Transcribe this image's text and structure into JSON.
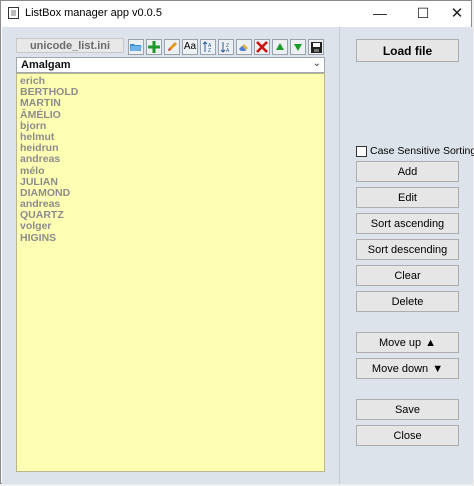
{
  "window": {
    "title": "ListBox manager app v0.0.5",
    "controls": {
      "minimize": "—",
      "maximize": "☐",
      "close": "✕"
    }
  },
  "file": {
    "name": "unicode_list.ini"
  },
  "toolbar": {
    "buttons": [
      {
        "name": "open-folder-icon",
        "glyph": ""
      },
      {
        "name": "add-icon",
        "glyph": ""
      },
      {
        "name": "edit-pencil-icon",
        "glyph": ""
      },
      {
        "name": "font-case-icon",
        "glyph": "Aa"
      },
      {
        "name": "sort-ascending-icon",
        "glyph": ""
      },
      {
        "name": "sort-descending-icon",
        "glyph": ""
      },
      {
        "name": "clear-eraser-icon",
        "glyph": ""
      },
      {
        "name": "delete-icon",
        "glyph": ""
      },
      {
        "name": "move-up-icon",
        "glyph": ""
      },
      {
        "name": "move-down-icon",
        "glyph": ""
      },
      {
        "name": "save-disk-icon",
        "glyph": ""
      }
    ]
  },
  "combo": {
    "selected": "Amalgam",
    "arrow": "⌄"
  },
  "list": {
    "items": [
      "erich",
      "BERTHOLD",
      "MARTIN",
      "ÂMÉLIO",
      "bjorn",
      "helmut",
      "heidrun",
      "andreas",
      "mélo",
      "JULIAN",
      "DIAMOND",
      "andreas",
      "QUARTZ",
      "volger",
      "HIGINS"
    ],
    "text_color": "#8c8c8c",
    "background": "#ffffb4"
  },
  "right": {
    "load_file": "Load file",
    "case_sensitive": "Case Sensitive Sorting",
    "case_sensitive_checked": false,
    "add": "Add",
    "edit": "Edit",
    "sort_ascending": "Sort ascending",
    "sort_descending": "Sort descending",
    "clear": "Clear",
    "delete": "Delete",
    "move_up": "Move up",
    "move_up_glyph": "▲",
    "move_down": "Move down",
    "move_down_glyph": "▼",
    "save": "Save",
    "close": "Close"
  }
}
